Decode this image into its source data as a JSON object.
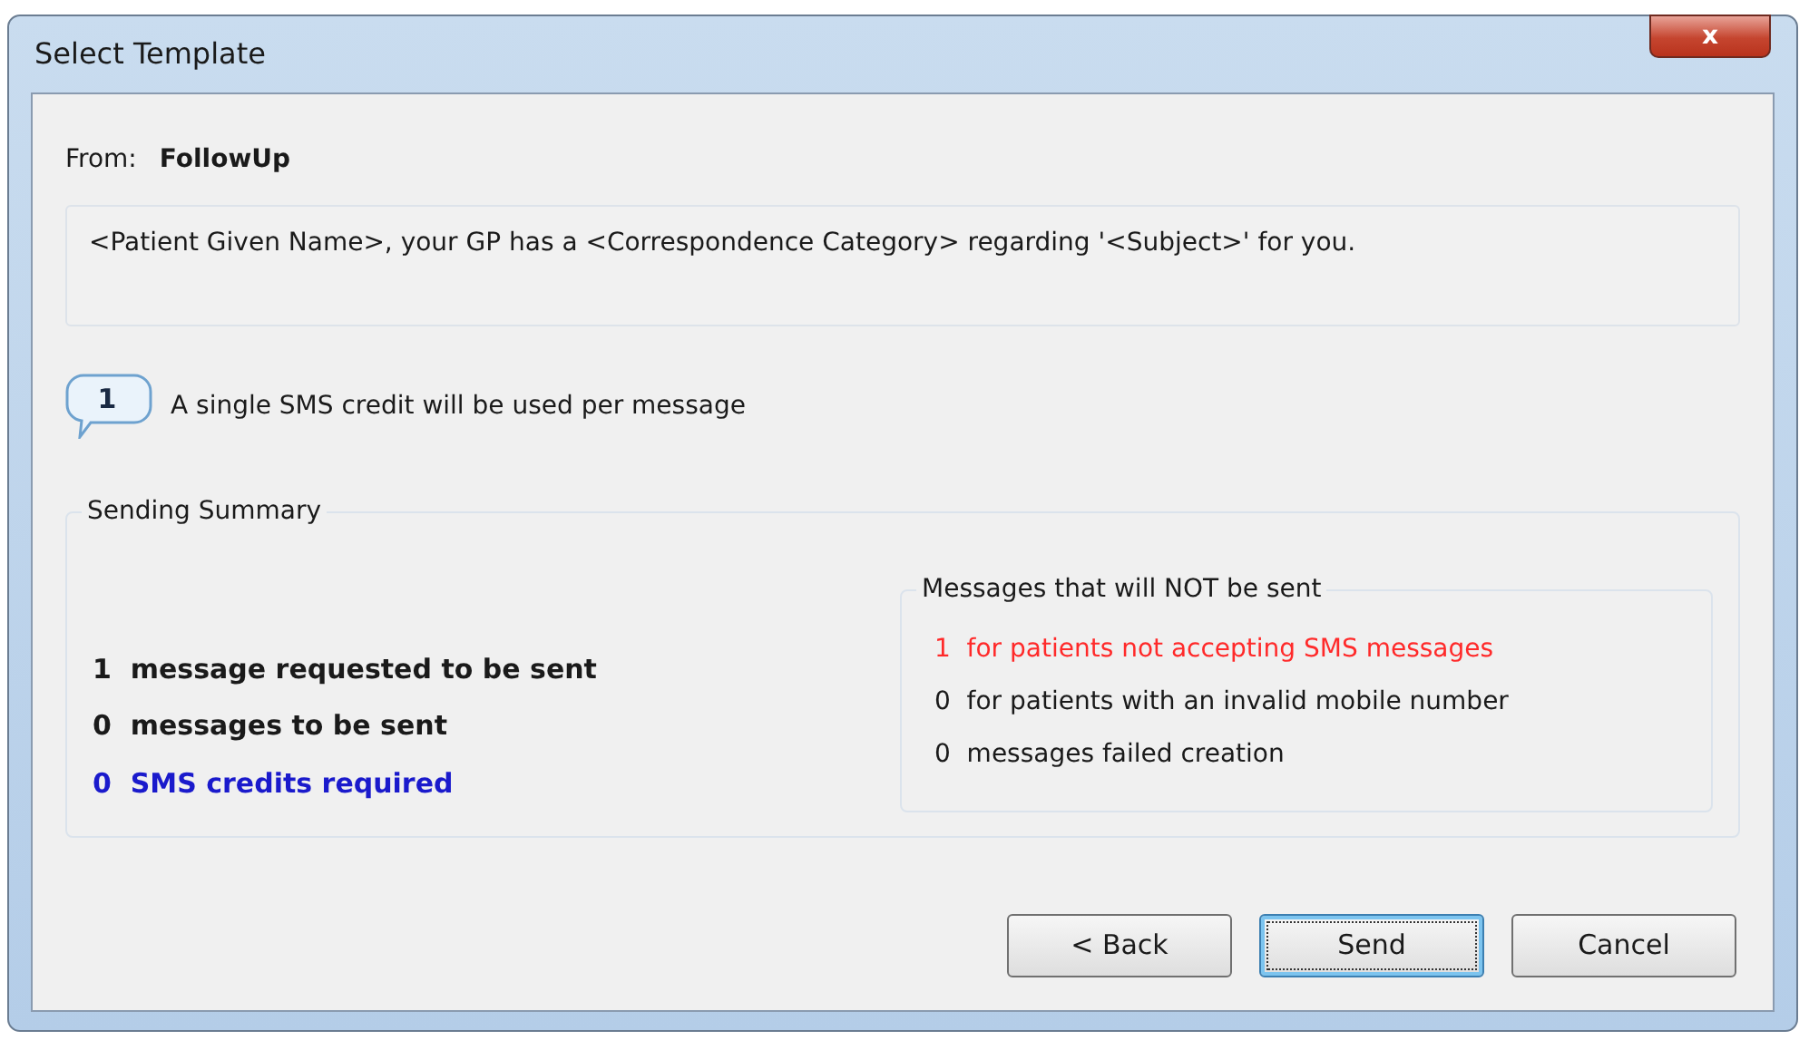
{
  "window": {
    "title": "Select Template",
    "close": "x"
  },
  "from": {
    "label": "From:",
    "value": "FollowUp"
  },
  "template_text": "<Patient Given Name>, your GP has a <Correspondence Category> regarding '<Subject>' for you.",
  "info": {
    "badge": "1",
    "text": "A single SMS credit will be used per message"
  },
  "summary": {
    "title": "Sending Summary",
    "lines": [
      {
        "count": "1",
        "text": "message requested to be sent",
        "color": "#1a1a1a"
      },
      {
        "count": "0",
        "text": "messages to be sent",
        "color": "#1a1a1a"
      },
      {
        "count": "0",
        "text": "SMS credits required",
        "color": "#1a1acc"
      }
    ],
    "not_sent": {
      "title": "Messages that will NOT be sent",
      "lines": [
        {
          "count": "1",
          "text": "for patients not accepting SMS messages",
          "color": "#ff2a2a"
        },
        {
          "count": "0",
          "text": "for patients with an invalid mobile number",
          "color": "#1a1a1a"
        },
        {
          "count": "0",
          "text": "messages failed creation",
          "color": "#1a1a1a"
        }
      ]
    }
  },
  "buttons": [
    {
      "label": "< Back",
      "default": false
    },
    {
      "label": "Send",
      "default": true
    },
    {
      "label": "Cancel",
      "default": false
    }
  ]
}
